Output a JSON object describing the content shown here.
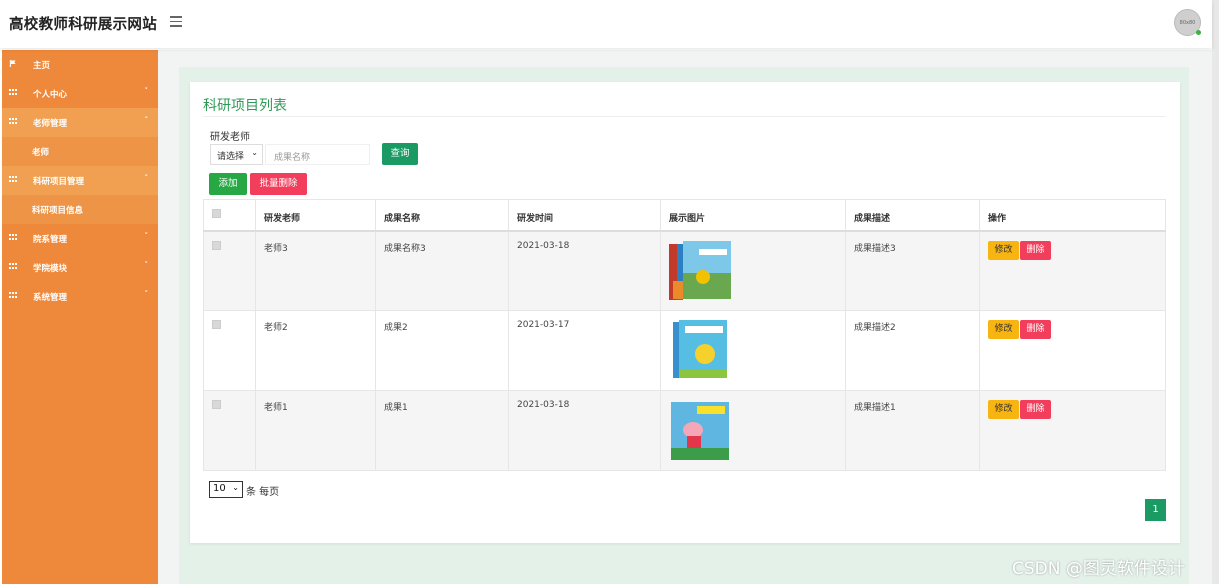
{
  "app": {
    "title": "高校教师科研展示网站",
    "avatar_text": "80x80"
  },
  "sidebar": {
    "items": [
      {
        "label": "主页",
        "icon": "flag-icon",
        "arrow": ""
      },
      {
        "label": "个人中心",
        "icon": "grid-icon",
        "arrow": "˅"
      },
      {
        "label": "老师管理",
        "icon": "grid-icon",
        "arrow": "˄"
      },
      {
        "label": "老师",
        "icon": "",
        "arrow": ""
      },
      {
        "label": "科研项目管理",
        "icon": "grid-icon",
        "arrow": "˄"
      },
      {
        "label": "科研项目信息",
        "icon": "",
        "arrow": ""
      },
      {
        "label": "院系管理",
        "icon": "grid-icon",
        "arrow": "˅"
      },
      {
        "label": "学院模块",
        "icon": "grid-icon",
        "arrow": "˅"
      },
      {
        "label": "系统管理",
        "icon": "grid-icon",
        "arrow": "˅"
      }
    ]
  },
  "main": {
    "title": "科研项目列表",
    "filter": {
      "label": "研发老师",
      "select_value": "请选择",
      "name_placeholder": "成果名称",
      "search_label": "查询"
    },
    "actions": {
      "add_label": "添加",
      "batch_delete_label": "批量删除"
    },
    "table": {
      "columns": [
        "研发老师",
        "成果名称",
        "研发时间",
        "展示图片",
        "成果描述",
        "操作"
      ],
      "rows": [
        {
          "teacher": "老师3",
          "name": "成果名称3",
          "date": "2021-03-18",
          "image": "book-cover-3",
          "desc": "成果描述3"
        },
        {
          "teacher": "老师2",
          "name": "成果2",
          "date": "2021-03-17",
          "image": "book-cover-2",
          "desc": "成果描述2"
        },
        {
          "teacher": "老师1",
          "name": "成果1",
          "date": "2021-03-18",
          "image": "book-cover-1",
          "desc": "成果描述1"
        }
      ],
      "edit_label": "修改",
      "delete_label": "删除"
    },
    "pager": {
      "page_size": "10",
      "page_size_suffix": "条 每页",
      "current_page": "1"
    }
  },
  "watermark": "CSDN @图灵软件设计",
  "colors": {
    "sidebar": "#ee883a",
    "primary_green": "#1b9a64",
    "danger": "#f23d5b",
    "warning": "#f8b512",
    "title_green": "#2e9a55"
  }
}
